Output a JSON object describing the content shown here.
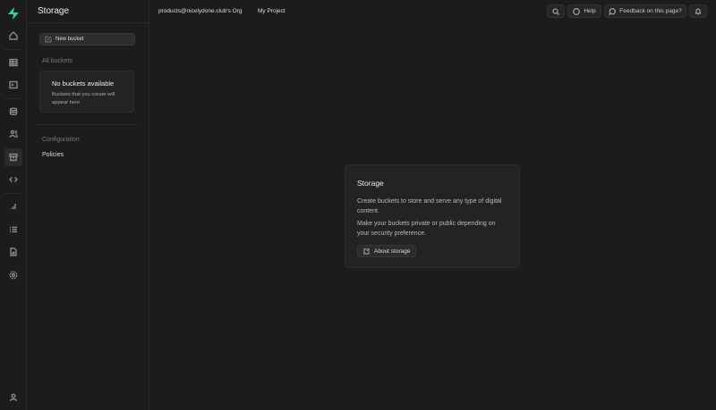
{
  "app": {
    "section_title": "Storage",
    "brand_color": "#3ecf8e"
  },
  "topbar": {
    "org": "products@nicelydone.club's Org",
    "project": "My Project",
    "help": "Help",
    "feedback": "Feedback on this page?"
  },
  "sidebar": {
    "new_bucket": "New bucket",
    "all_buckets": "All buckets",
    "empty_title": "No buckets available",
    "empty_desc": "Buckets that you create will appear here",
    "configuration": "Configuration",
    "policies": "Policies"
  },
  "card": {
    "title": "Storage",
    "p1": "Create buckets to store and serve any type of digital content.",
    "p2": "Make your buckets private or public depending on your security preference.",
    "button": "About storage"
  }
}
